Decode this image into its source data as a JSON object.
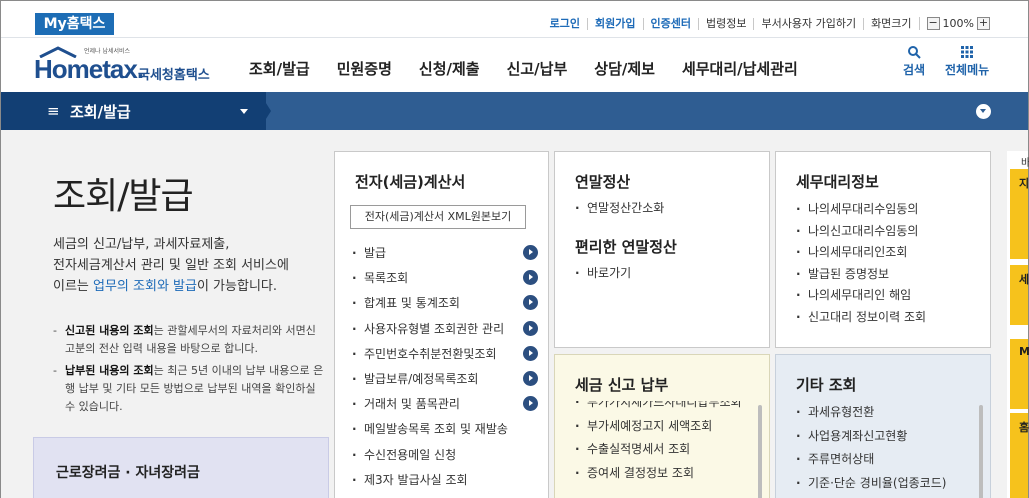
{
  "top": {
    "my_hometax": "My홈택스",
    "utils": [
      {
        "label": "로그인",
        "accent": true
      },
      {
        "label": "회원가입",
        "accent": true
      },
      {
        "label": "인증센터",
        "accent": true
      },
      {
        "label": "법령정보",
        "accent": false
      },
      {
        "label": "부서사용자 가입하기",
        "accent": false
      },
      {
        "label": "화면크기",
        "accent": false
      }
    ],
    "zoom_minus": "−",
    "zoom_value": "100%",
    "zoom_plus": "+"
  },
  "header": {
    "logo_sub": "언제나 납세서비스",
    "logo_text": "Hometax.",
    "logo_kr": "국세청홈택스",
    "nav": [
      "조회/발급",
      "민원증명",
      "신청/제출",
      "신고/납부",
      "상담/제보",
      "세무대리/납세관리"
    ],
    "search_label": "검색",
    "allmenu_label": "전체메뉴"
  },
  "bar": {
    "title": "조회/발급"
  },
  "page": {
    "title": "조회/발급",
    "intro_1": "세금의 신고/납부, 과세자료제출,",
    "intro_2": "전자세금계산서 관리 및 일반 조회 서비스에",
    "intro_3_pre": "이르는 ",
    "intro_3_hl": "업무의 조회와 발급",
    "intro_3_post": "이 가능합니다.",
    "note1_bold": "신고된 내용의 조회",
    "note1_rest": "는 관할세무서의 자료처리와 서면신고분의 전산 입력 내용을 바탕으로 합니다.",
    "note2_bold": "납부된 내용의 조회",
    "note2_rest": "는 최근 5년 이내의 납부 내용으로 은행 납부 및 기타 모든 방법으로 납부된 내역을 확인하실 수 있습니다.",
    "box_label": "근로장려금 · 자녀장려금"
  },
  "cards": {
    "einvoice": {
      "title": "전자(세금)계산서",
      "xml_button": "전자(세금)계산서 XML원본보기",
      "items": [
        "발급",
        "목록조회",
        "합계표 및 통계조회",
        "사용자유형별 조회권한 관리",
        "주민번호수취분전환및조회",
        "발급보류/예정목록조회",
        "거래처 및 품목관리",
        "메일발송목록 조회 및 재발송",
        "수신전용메일 신청",
        "제3자 발급사실 조회"
      ],
      "arrows": [
        true,
        true,
        true,
        true,
        true,
        true,
        true,
        false,
        false,
        false
      ]
    },
    "yearend": {
      "title": "연말정산",
      "items": [
        "연말정산간소화"
      ],
      "title2": "편리한 연말정산",
      "items2": [
        "바로가기"
      ]
    },
    "agent": {
      "title": "세무대리정보",
      "items": [
        "나의세무대리수임동의",
        "나의신고대리수임동의",
        "나의세무대리인조회",
        "발급된 증명정보",
        "나의세무대리인 해임",
        "신고대리 정보이력 조회"
      ]
    },
    "taxpay": {
      "title": "세금 신고 납부",
      "items": [
        "부가가치세카드사대리납부조회",
        "부가세예정고지 세액조회",
        "수출실적명세서 조회",
        "증여세 결정정보 조회"
      ]
    },
    "other": {
      "title": "기타 조회",
      "items": [
        "과세유형전환",
        "사업용계좌신고현황",
        "주류면허상태",
        "기준·단순 경비율(업종코드)"
      ]
    }
  },
  "right_edge": {
    "label": "바",
    "boxes": [
      "지",
      "세",
      "My",
      "홈"
    ]
  }
}
